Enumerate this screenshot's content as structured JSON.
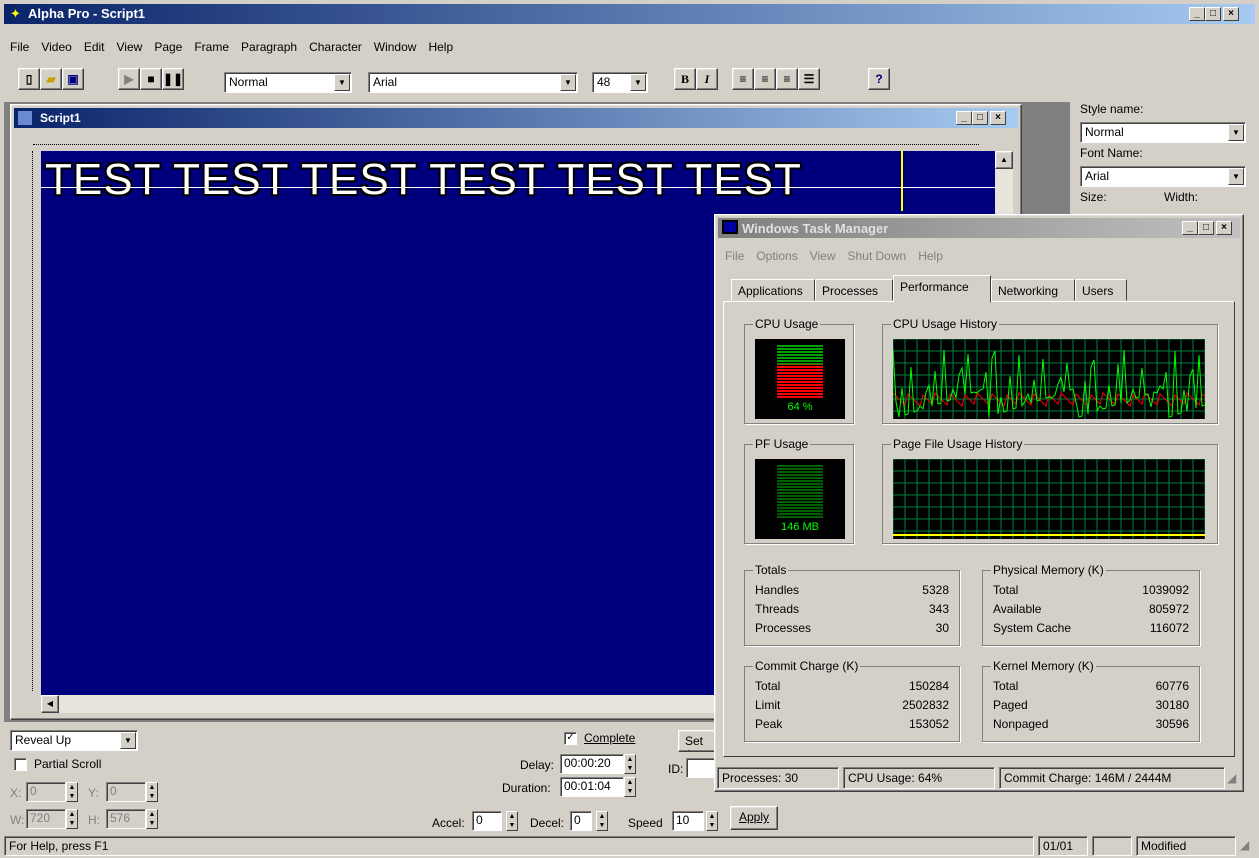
{
  "app": {
    "title": "Alpha Pro - Script1",
    "menu": [
      "File",
      "Video",
      "Edit",
      "View",
      "Page",
      "Frame",
      "Paragraph",
      "Character",
      "Window",
      "Help"
    ]
  },
  "toolbar": {
    "style_value": "Normal",
    "font_value": "Arial",
    "size_value": "48",
    "bold_label": "B",
    "italic_label": "I",
    "help_label": "?"
  },
  "script_window": {
    "title": "Script1",
    "canvas_text": "TEST TEST TEST TEST TEST TEST",
    "canvas_bg": "#00007f"
  },
  "right_panel": {
    "style_name_label": "Style name:",
    "style_name_value": "Normal",
    "font_name_label": "Font Name:",
    "font_name_value": "Arial",
    "size_label": "Size:",
    "width_label": "Width:"
  },
  "bottom": {
    "effect_value": "Reveal Up",
    "partial_scroll_label": "Partial Scroll",
    "x_label": "X:",
    "x_value": "0",
    "y_label": "Y:",
    "y_value": "0",
    "w_label": "W:",
    "w_value": "720",
    "h_label": "H:",
    "h_value": "576",
    "complete_label": "Complete",
    "delay_label": "Delay:",
    "delay_value": "00:00:20",
    "duration_label": "Duration:",
    "duration_value": "00:01:04",
    "set_label": "Set A",
    "id_label": "ID:",
    "accel_label": "Accel:",
    "accel_value": "0",
    "decel_label": "Decel:",
    "decel_value": "0",
    "speed_label": "Speed",
    "speed_value": "10",
    "apply_label": "Apply"
  },
  "statusbar": {
    "help_text": "For Help, press F1",
    "page": "01/01",
    "state": "Modified"
  },
  "task_manager": {
    "title": "Windows Task Manager",
    "menu": [
      "File",
      "Options",
      "View",
      "Shut Down",
      "Help"
    ],
    "tabs": [
      "Applications",
      "Processes",
      "Performance",
      "Networking",
      "Users"
    ],
    "active_tab": "Performance",
    "cpu_usage_label": "CPU Usage",
    "cpu_usage_value": "64 %",
    "cpu_usage_fraction": 0.64,
    "cpu_history_label": "CPU Usage History",
    "pf_usage_label": "PF Usage",
    "pf_usage_value": "146 MB",
    "pf_history_label": "Page File Usage History",
    "totals": {
      "label": "Totals",
      "rows": [
        [
          "Handles",
          "5328"
        ],
        [
          "Threads",
          "343"
        ],
        [
          "Processes",
          "30"
        ]
      ]
    },
    "physical": {
      "label": "Physical Memory (K)",
      "rows": [
        [
          "Total",
          "1039092"
        ],
        [
          "Available",
          "805972"
        ],
        [
          "System Cache",
          "116072"
        ]
      ]
    },
    "commit": {
      "label": "Commit Charge (K)",
      "rows": [
        [
          "Total",
          "150284"
        ],
        [
          "Limit",
          "2502832"
        ],
        [
          "Peak",
          "153052"
        ]
      ]
    },
    "kernel": {
      "label": "Kernel Memory (K)",
      "rows": [
        [
          "Total",
          "60776"
        ],
        [
          "Paged",
          "30180"
        ],
        [
          "Nonpaged",
          "30596"
        ]
      ]
    },
    "status": {
      "processes": "Processes: 30",
      "cpu": "CPU Usage: 64%",
      "commit": "Commit Charge: 146M / 2444M"
    },
    "colors": {
      "graph_bg": "#000000",
      "grid": "#008040",
      "line": "#00ff00",
      "kernel_line": "#ff0000",
      "bar_used": "#ff0000",
      "bar_free": "#00a000"
    }
  }
}
